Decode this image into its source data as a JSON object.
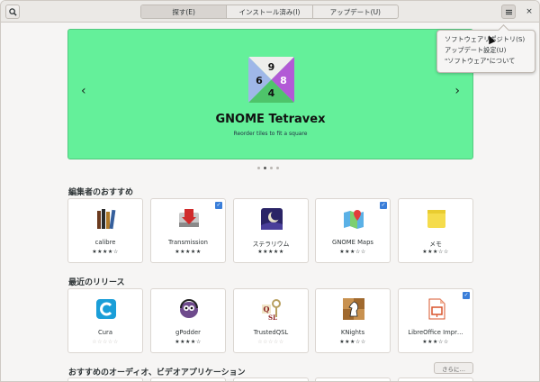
{
  "header": {
    "tabs": [
      {
        "label": "探す(E)",
        "active": true
      },
      {
        "label": "インストール済み(I)",
        "active": false
      },
      {
        "label": "アップデート(U)",
        "active": false
      }
    ],
    "search_icon": "search-icon",
    "menu_icon": "hamburger-menu-icon",
    "close_label": "×"
  },
  "menu": {
    "items": [
      "ソフトウェアリポジトリ(S)",
      "アップデート設定(U)",
      "\"ソフトウェア\"について"
    ]
  },
  "banner": {
    "title": "GNOME Tetravex",
    "subtitle": "Reorder tiles to fit a square",
    "tile_numbers": [
      "9",
      "6",
      "8",
      "4"
    ],
    "prev": "‹",
    "next": "›",
    "bg_color": "#64f09a",
    "pages": 4,
    "active_page": 2
  },
  "editors": {
    "title": "編集者のおすすめ",
    "apps": [
      {
        "name": "calibre",
        "stars": "★★★★☆",
        "installed": false
      },
      {
        "name": "Transmission",
        "stars": "★★★★★",
        "installed": true
      },
      {
        "name": "ステラリウム",
        "stars": "★★★★★",
        "installed": false
      },
      {
        "name": "GNOME Maps",
        "stars": "★★★☆☆",
        "installed": true
      },
      {
        "name": "メモ",
        "stars": "★★★☆☆",
        "installed": false
      }
    ]
  },
  "recent": {
    "title": "最近のリリース",
    "apps": [
      {
        "name": "Cura",
        "stars": "☆☆☆☆☆",
        "installed": false
      },
      {
        "name": "gPodder",
        "stars": "★★★★☆",
        "installed": false
      },
      {
        "name": "TrustedQSL",
        "stars": "☆☆☆☆☆",
        "installed": false
      },
      {
        "name": "KNights",
        "stars": "★★★☆☆",
        "installed": false
      },
      {
        "name": "LibreOffice Impr…",
        "stars": "★★★☆☆",
        "installed": true
      }
    ]
  },
  "audio_video": {
    "title": "おすすめのオーディオ、ビデオアプリケーション",
    "more_label": "さらに…"
  },
  "check_mark": "✓"
}
